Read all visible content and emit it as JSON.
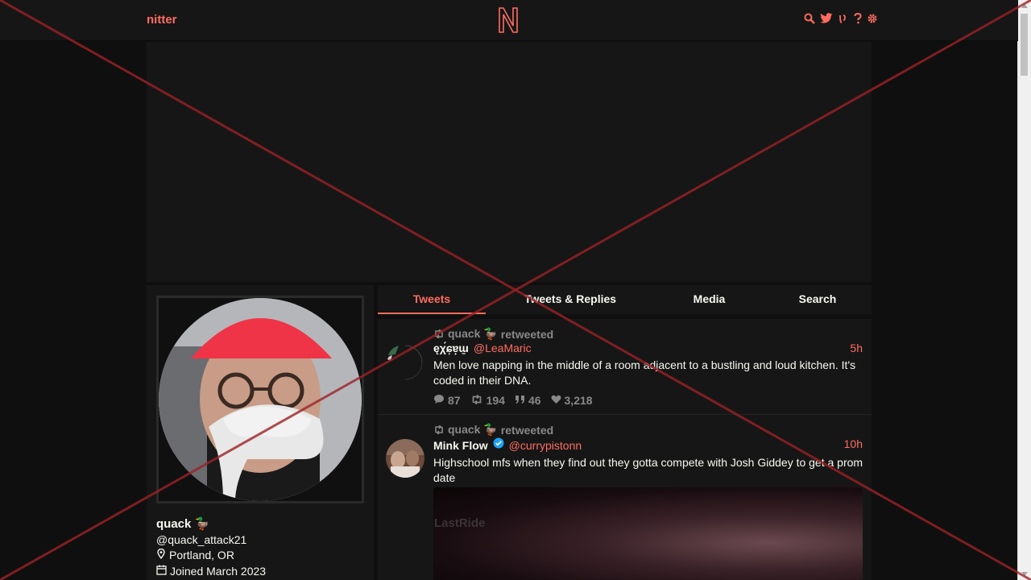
{
  "nav": {
    "brand": "nitter"
  },
  "profile": {
    "fullname": "quack 🦆",
    "username": "@quack_attack21",
    "location": "Portland, OR",
    "joined": "Joined March 2023"
  },
  "tabs": [
    {
      "label": "Tweets",
      "selected": true
    },
    {
      "label": "Tweets & Replies",
      "selected": false
    },
    {
      "label": "Media",
      "selected": false
    },
    {
      "label": "Search",
      "selected": false
    }
  ],
  "tweets": [
    {
      "retweet_by": "quack 🦆",
      "retweet_label": "retweeted",
      "fullname": "ęχ́ɕ̜ɐ̟ɯ̱",
      "handle": "@LeaMaric",
      "date": "5h",
      "text": "Men love napping in the middle of a room adjacent to a bustling and loud kitchen. It's coded in their DNA.",
      "replies": "87",
      "retweets": "194",
      "quotes": "46",
      "likes": "3,218"
    },
    {
      "retweet_by": "quack 🦆",
      "retweet_label": "retweeted",
      "fullname": "Mink Flow",
      "verified": true,
      "handle": "@currypistonn",
      "date": "10h",
      "text": "Highschool mfs when they find out they gotta compete with Josh Giddey to get a prom date",
      "media_watermark": "LastRide"
    }
  ],
  "colors": {
    "accent": "#ff6c60",
    "background": "#0f0f0f",
    "panel": "#161616",
    "muted": "#888889"
  }
}
